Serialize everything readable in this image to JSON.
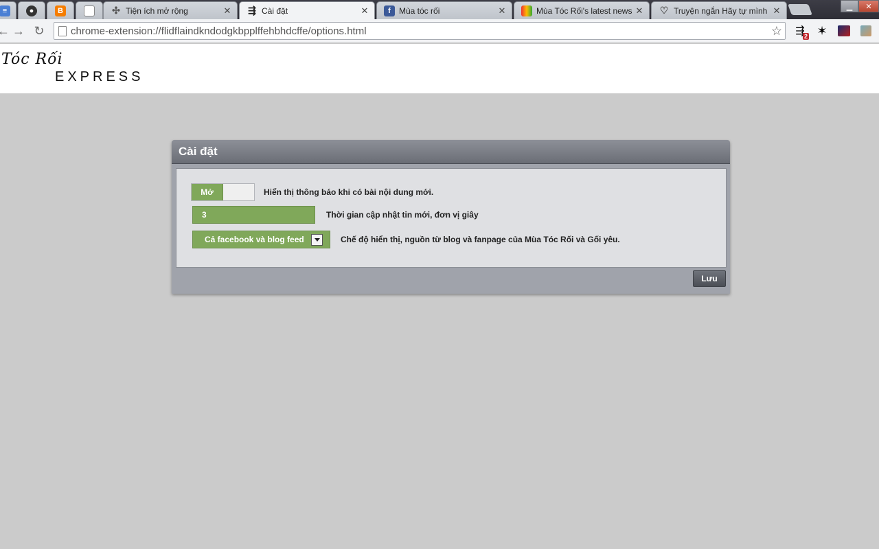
{
  "browser": {
    "tabs": [
      {
        "title": "",
        "icon": "docs-icon",
        "active": false
      },
      {
        "title": "",
        "icon": "github-icon",
        "active": false
      },
      {
        "title": "",
        "icon": "blogger-icon",
        "active": false
      },
      {
        "title": "",
        "icon": "page-icon",
        "active": false
      },
      {
        "title": "Tiện ích mở rộng",
        "icon": "puzzle-icon",
        "active": false
      },
      {
        "title": "Cài đặt",
        "icon": "settings-sliders-icon",
        "active": true
      },
      {
        "title": "Mùa tóc rối",
        "icon": "facebook-icon",
        "active": false
      },
      {
        "title": "Mùa Tóc Rối's latest news",
        "icon": "rss-icon",
        "active": false
      },
      {
        "title": "Truyện ngắn Hãy tự mình",
        "icon": "heart-icon",
        "active": false
      }
    ],
    "url": "chrome-extension://flidflaindkndodgkbpplffehbhdcffe/options.html",
    "extension_badge": "2"
  },
  "header": {
    "logo_top": "Tóc Rối",
    "logo_bottom": "EXPRESS"
  },
  "settings": {
    "title": "Cài đặt",
    "notify_toggle_label": "Mở",
    "notify_description": "Hiển thị thông báo khi có bài nội dung mới.",
    "interval_value": "3",
    "interval_description": "Thời gian cập nhật tin mới, đơn vị giây",
    "mode_selected": "Cả facebook và blog feed",
    "mode_description": "Chế độ hiển thị, nguồn từ blog và fanpage của Mùa Tóc Rối và Gối yêu.",
    "save_label": "Lưu"
  },
  "colors": {
    "accent_green": "#80a85a",
    "page_background": "#cbcbcb"
  }
}
